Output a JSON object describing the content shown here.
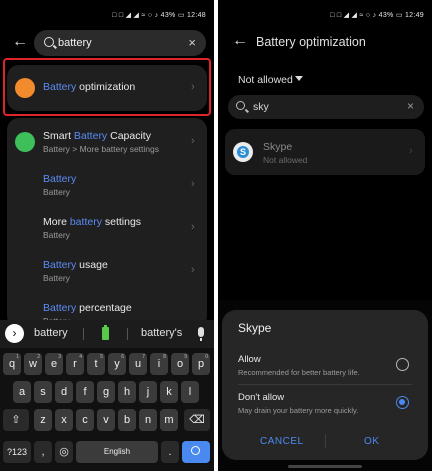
{
  "left": {
    "status": "□ □ ◢ ◢ ≈ ○ ♪ 43% ▭ 12:48",
    "search_value": "battery",
    "first_result": {
      "highlight": "Battery",
      "rest": " optimization"
    },
    "results": [
      {
        "title_pre": "Smart ",
        "title_hl": "Battery",
        "title_post": " Capacity",
        "sub": "Battery > More battery settings"
      },
      {
        "title_pre": "",
        "title_hl": "Battery",
        "title_post": "",
        "sub": "Battery"
      },
      {
        "title_pre": "More ",
        "title_hl": "battery",
        "title_post": " settings",
        "sub": "Battery"
      },
      {
        "title_pre": "",
        "title_hl": "Battery",
        "title_post": " usage",
        "sub": "Battery"
      },
      {
        "title_pre": "",
        "title_hl": "Battery",
        "title_post": " percentage",
        "sub": "Battery"
      }
    ],
    "suggestions": [
      "battery",
      "battery's"
    ],
    "keyboard": {
      "row1": [
        "q",
        "w",
        "e",
        "r",
        "t",
        "y",
        "u",
        "i",
        "o",
        "p"
      ],
      "row1_nums": [
        "1",
        "2",
        "3",
        "4",
        "5",
        "6",
        "7",
        "8",
        "9",
        "0"
      ],
      "row2": [
        "a",
        "s",
        "d",
        "f",
        "g",
        "h",
        "j",
        "k",
        "l"
      ],
      "row3": [
        "z",
        "x",
        "c",
        "v",
        "b",
        "n",
        "m"
      ],
      "sym": "?123",
      "comma": ",",
      "space": "English",
      "period": "."
    }
  },
  "right": {
    "status": "□ □ ◢ ◢ ≈ ○ ♪ 43% ▭ 12:49",
    "title": "Battery optimization",
    "filter": "Not allowed",
    "search_value": "sky",
    "app": {
      "name": "Skype",
      "status": "Not allowed"
    },
    "dialog": {
      "title": "Skype",
      "options": [
        {
          "title": "Allow",
          "sub": "Recommended for better battery life.",
          "selected": false
        },
        {
          "title": "Don't allow",
          "sub": "May drain your battery more quickly.",
          "selected": true
        }
      ],
      "cancel": "CANCEL",
      "ok": "OK"
    }
  },
  "colors": {
    "highlight": "#5b8cf5",
    "accent": "#4a8af0",
    "red_box": "#e0242c"
  }
}
